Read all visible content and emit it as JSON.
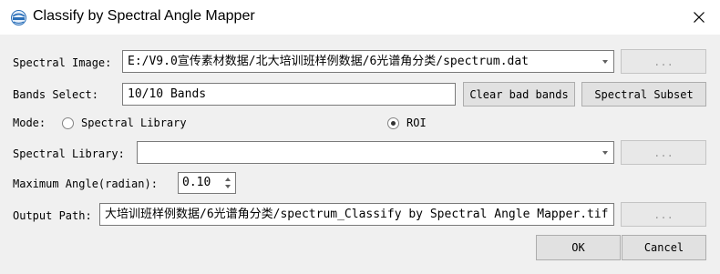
{
  "window": {
    "title": "Classify by Spectral Angle Mapper",
    "app_icon": "app-logo-icon",
    "close_icon": "close-icon"
  },
  "spectral_image": {
    "label": "Spectral Image:",
    "value": "E:/V9.0宣传素材数据/北大培训班样例数据/6光谱角分类/spectrum.dat",
    "browse_label": "..."
  },
  "bands_select": {
    "label": "Bands Select:",
    "value": "10/10 Bands",
    "clear_bad_bands_label": "Clear bad bands",
    "spectral_subset_label": "Spectral Subset"
  },
  "mode": {
    "label": "Mode:",
    "options": [
      {
        "label": "Spectral Library",
        "checked": false
      },
      {
        "label": "ROI",
        "checked": true
      }
    ]
  },
  "spectral_library": {
    "label": "Spectral Library:",
    "value": "",
    "browse_label": "..."
  },
  "maximum_angle": {
    "label": "Maximum Angle(radian):",
    "value": "0.10"
  },
  "output_path": {
    "label": "Output Path:",
    "value": "大培训班样例数据/6光谱角分类/spectrum_Classify by Spectral Angle Mapper.tif",
    "browse_label": "..."
  },
  "footer": {
    "ok_label": "OK",
    "cancel_label": "Cancel"
  },
  "colors": {
    "background": "#f0f0f0",
    "titlebar": "#ffffff",
    "button": "#e1e1e1"
  }
}
